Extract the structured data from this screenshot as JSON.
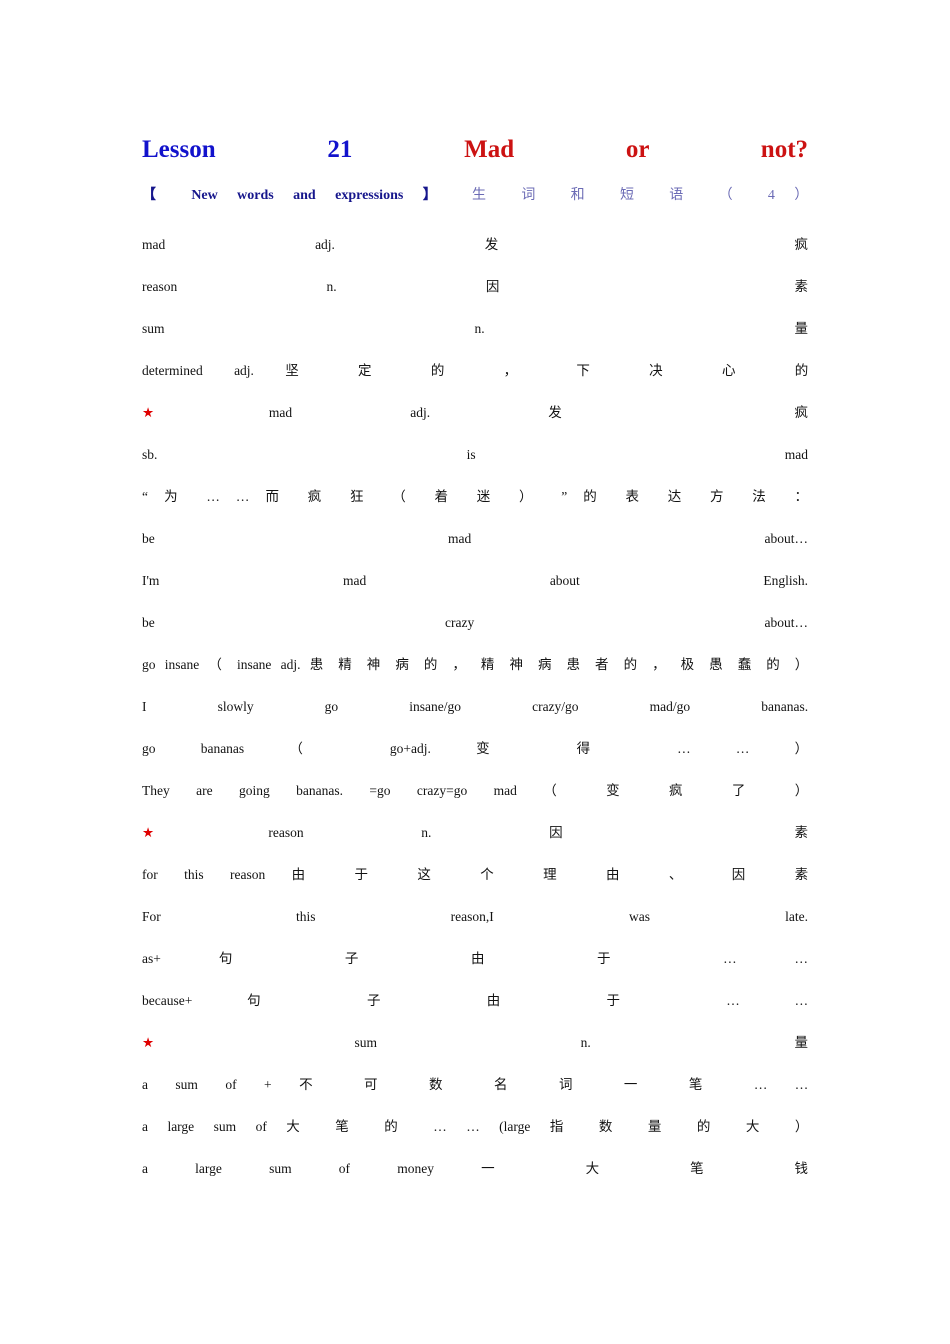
{
  "document": {
    "page_background": "#ffffff",
    "title_blue_color": "#1212CC",
    "title_red_color": "#CC1212",
    "heading_navy_color": "#16168C",
    "heading_soft_blue_color": "#6B6BB5",
    "star_color": "#E00000",
    "body_text_color": "#121212"
  },
  "title": {
    "lesson_word": "Lesson",
    "lesson_number": "21",
    "subject_1": "Mad",
    "subject_2": "or",
    "subject_3": "not?"
  },
  "heading": {
    "bracket_open": "【",
    "en_1": "New",
    "en_2": "words",
    "en_3": "and",
    "en_4": "expressions",
    "bracket_close": "】",
    "cn_1": "生",
    "cn_2": "词",
    "cn_3": "和",
    "cn_4": "短",
    "cn_5": "语",
    "paren_open": "（",
    "count": "4",
    "paren_close": "）"
  },
  "lines": [
    {
      "id": "mad-entry",
      "star": false,
      "tokens": [
        "mad",
        "adj.",
        "发",
        "疯"
      ]
    },
    {
      "id": "reason-entry",
      "star": false,
      "tokens": [
        "reason",
        "n.",
        "因",
        "素"
      ]
    },
    {
      "id": "sum-entry",
      "star": false,
      "tokens": [
        "sum",
        "n.",
        "量"
      ]
    },
    {
      "id": "determined-entry",
      "star": false,
      "tokens": [
        "determined",
        "adj.",
        "坚",
        "定",
        "的",
        "，",
        "下",
        "决",
        "心",
        "的"
      ]
    },
    {
      "id": "mad-detail",
      "star": true,
      "tokens": [
        "mad",
        "adj.",
        "发",
        "疯"
      ]
    },
    {
      "id": "sb-is-mad",
      "star": false,
      "tokens": [
        "sb.",
        "is",
        "mad"
      ]
    },
    {
      "id": "crazy-about-note",
      "star": false,
      "tokens": [
        "“",
        "为",
        "…",
        "…",
        "而",
        "疯",
        "狂",
        "（",
        "着",
        "迷",
        "）",
        "”",
        "的",
        "表",
        "达",
        "方",
        "法",
        "："
      ]
    },
    {
      "id": "be-mad-about",
      "star": false,
      "tokens": [
        "be",
        "mad",
        "about…"
      ]
    },
    {
      "id": "im-mad-about",
      "star": false,
      "tokens": [
        "I'm",
        "mad",
        "about",
        "English."
      ]
    },
    {
      "id": "be-crazy-about",
      "star": false,
      "tokens": [
        "be",
        "crazy",
        "about…"
      ]
    },
    {
      "id": "go-insane",
      "star": false,
      "tokens": [
        "go",
        "insane",
        "（",
        "insane",
        "adj.",
        "患",
        "精",
        "神",
        "病",
        "的",
        "，",
        "精",
        "神",
        "病",
        "患",
        "者",
        "的",
        "，",
        "极",
        "愚",
        "蠢",
        "的",
        "）"
      ]
    },
    {
      "id": "slowly-go-insane",
      "star": false,
      "tokens": [
        "I",
        "slowly",
        "go",
        "insane/go",
        "crazy/go",
        "mad/go",
        "bananas."
      ]
    },
    {
      "id": "go-bananas",
      "star": false,
      "tokens": [
        "go",
        "bananas",
        "（",
        "go+adj.",
        "变",
        "得",
        "…",
        "…",
        "）"
      ]
    },
    {
      "id": "they-going-bananas",
      "star": false,
      "tokens": [
        "They",
        "are",
        "going",
        "bananas.",
        "=go",
        "crazy=go",
        "mad",
        "（",
        "变",
        "疯",
        "了",
        "）"
      ]
    },
    {
      "id": "reason-detail",
      "star": true,
      "tokens": [
        "reason",
        "n.",
        "因",
        "素"
      ]
    },
    {
      "id": "for-this-reason",
      "star": false,
      "tokens": [
        "for",
        "this",
        "reason",
        "由",
        "于",
        "这",
        "个",
        "理",
        "由",
        "、",
        "因",
        "素"
      ]
    },
    {
      "id": "for-this-reason-ex",
      "star": false,
      "tokens": [
        "For",
        "this",
        "reason,I",
        "was",
        "late."
      ]
    },
    {
      "id": "as-clause",
      "star": false,
      "tokens": [
        "as+",
        "句",
        "子",
        "由",
        "于",
        "…",
        "…"
      ]
    },
    {
      "id": "because-clause",
      "star": false,
      "tokens": [
        "because+",
        "句",
        "子",
        "由",
        "于",
        "…",
        "…"
      ]
    },
    {
      "id": "sum-detail",
      "star": true,
      "tokens": [
        "sum",
        "n.",
        "量"
      ]
    },
    {
      "id": "a-sum-of",
      "star": false,
      "tokens": [
        "a",
        "sum",
        "of",
        "+",
        "不",
        "可",
        "数",
        "名",
        "词",
        "一",
        "笔",
        "…",
        "…"
      ]
    },
    {
      "id": "a-large-sum-of",
      "star": false,
      "tokens": [
        "a",
        "large",
        "sum",
        "of",
        "大",
        "笔",
        "的",
        "…",
        "…",
        "(large",
        "指",
        "数",
        "量",
        "的",
        "大",
        "）"
      ]
    },
    {
      "id": "a-large-sum-money",
      "star": false,
      "tokens": [
        "a",
        "large",
        "sum",
        "of",
        "money",
        "一",
        "大",
        "笔",
        "钱"
      ]
    }
  ]
}
